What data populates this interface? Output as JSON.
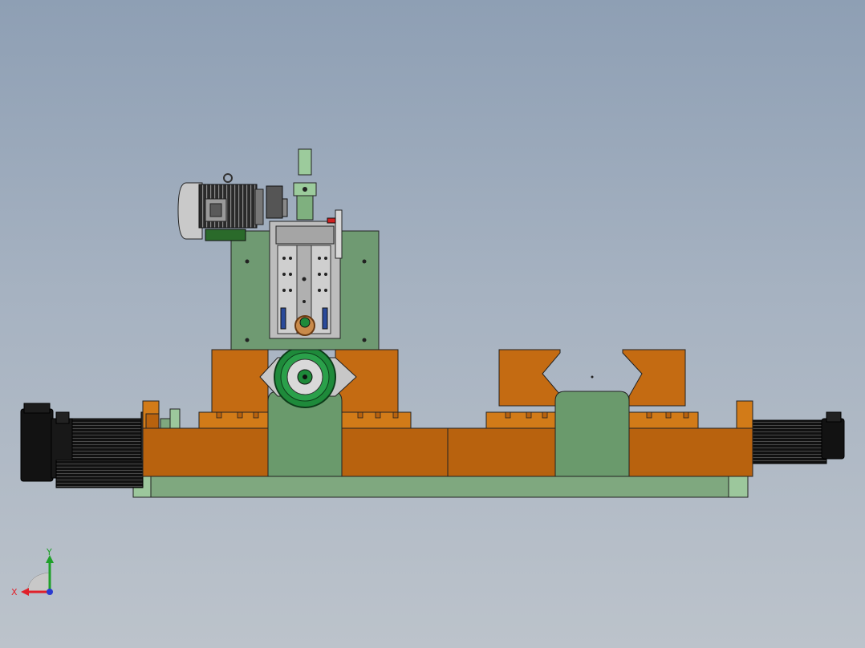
{
  "triad": {
    "x_label": "X",
    "y_label": "Y",
    "x_color": "#e0202a",
    "y_color": "#1fa02a",
    "z_color": "#2a3ad0"
  },
  "colors": {
    "machine_orange": "#b8620e",
    "machine_green": "#6f9a72",
    "light_green": "#9ccb9c",
    "steel_gray": "#b9b9b9",
    "motor_black": "#1a1a1a"
  },
  "model": {
    "assembly": "machine-assembly",
    "view": "front"
  }
}
